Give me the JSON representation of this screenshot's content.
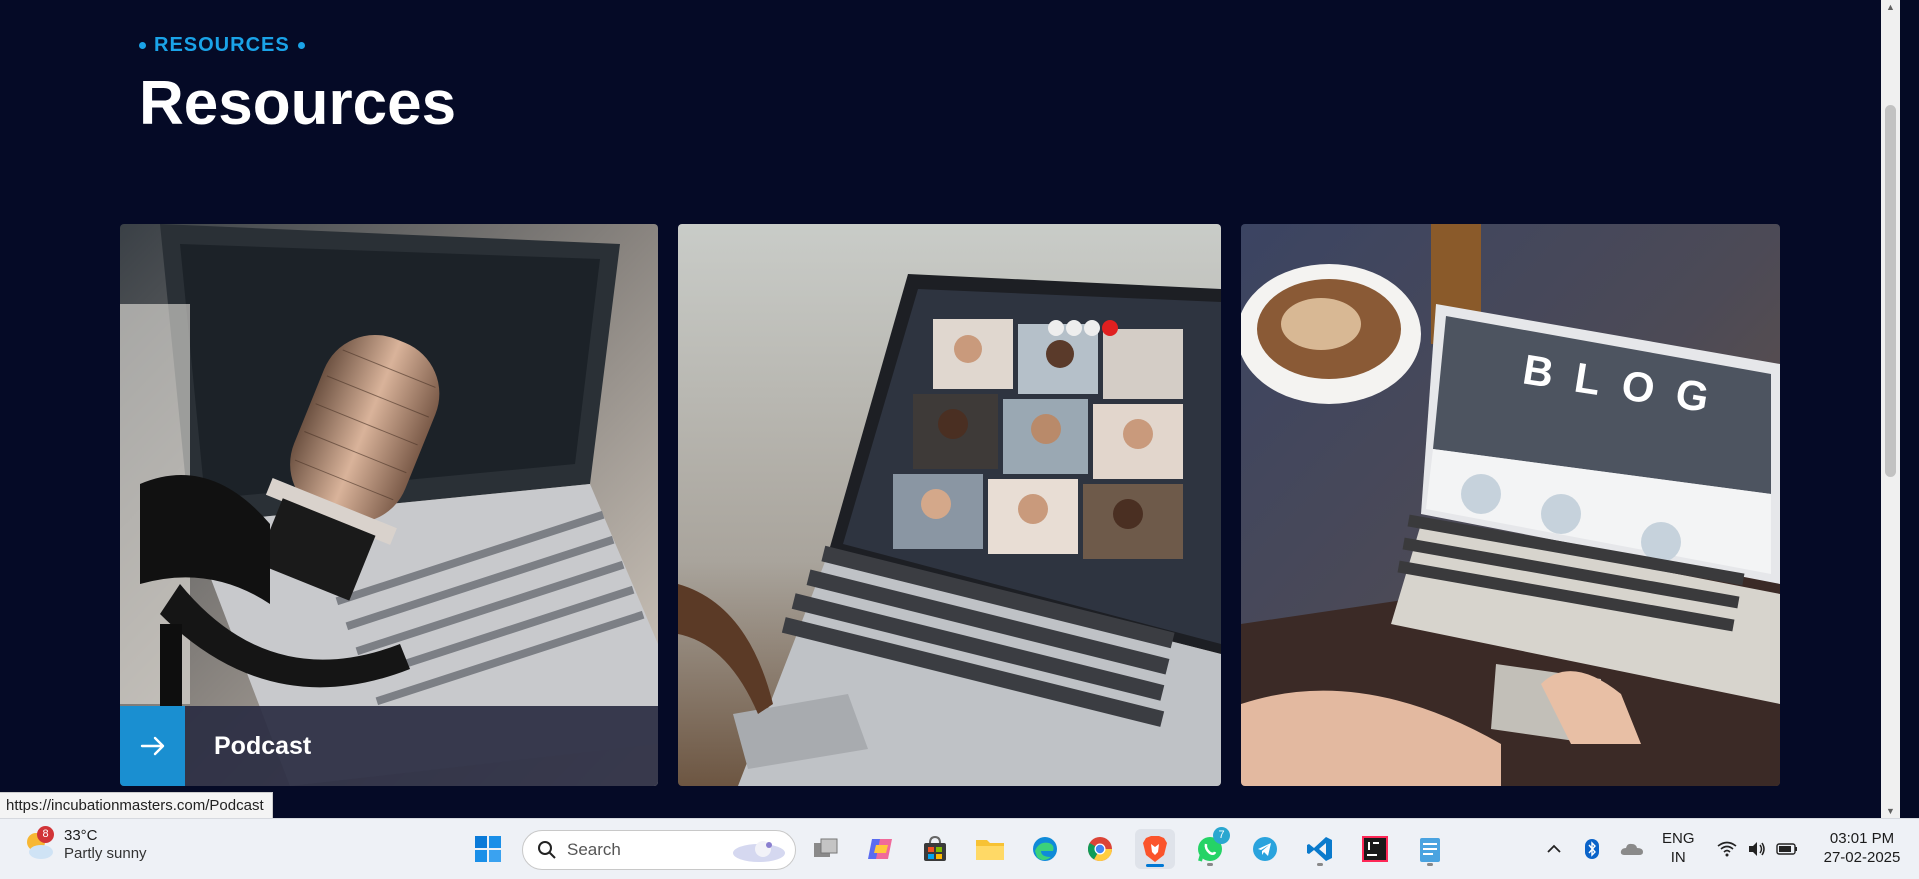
{
  "section": {
    "eyebrow": "RESOURCES",
    "title": "Resources"
  },
  "cards": [
    {
      "image": "podcast-microphone-laptop",
      "caption": "Podcast",
      "arrow_icon": "arrow-right-icon"
    },
    {
      "image": "video-conference-laptop"
    },
    {
      "image": "blog-laptop-coffee",
      "overlay_text": "BLOG"
    }
  ],
  "status_bar": {
    "url": "https://incubationmasters.com/Podcast"
  },
  "taskbar": {
    "weather": {
      "badge": "8",
      "temp": "33°C",
      "condition": "Partly sunny"
    },
    "search_placeholder": "Search",
    "whatsapp_badge": "7",
    "language": {
      "line1": "ENG",
      "line2": "IN"
    },
    "time": "03:01 PM",
    "date": "27-02-2025"
  },
  "colors": {
    "accent": "#1aa3e8",
    "background": "#050a26",
    "caption_bg": "#2a2c42",
    "arrow_bg": "#1a8fd1"
  }
}
